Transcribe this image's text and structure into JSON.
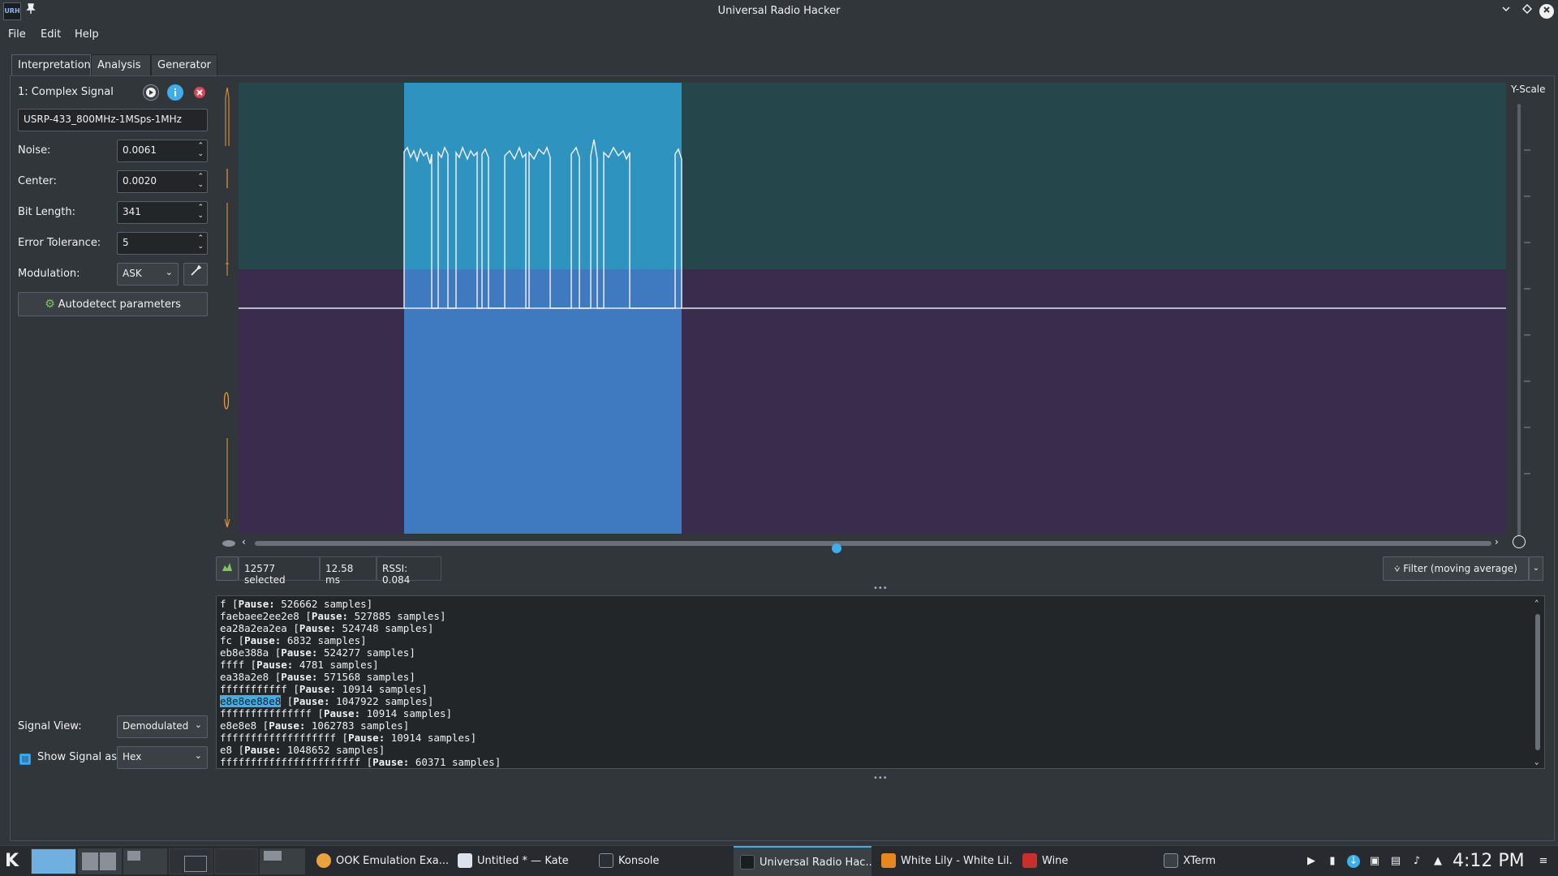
{
  "window": {
    "title": "Universal Radio Hacker",
    "app_icon_text": "URH"
  },
  "menu": [
    "File",
    "Edit",
    "Help"
  ],
  "tabs": [
    "Interpretation",
    "Analysis",
    "Generator"
  ],
  "signal": {
    "name": "1: Complex Signal",
    "filename": "USRP-433_800MHz-1MSps-1MHz"
  },
  "params": {
    "noise_label": "Noise:",
    "noise_value": "0.0061",
    "center_label": "Center:",
    "center_value": "0.0020",
    "bit_length_label": "Bit Length:",
    "bit_length_value": "341",
    "error_tolerance_label": "Error Tolerance:",
    "error_tolerance_value": "5",
    "modulation_label": "Modulation:",
    "modulation_value": "ASK",
    "autodetect_label": "Autodetect parameters",
    "signal_view_label": "Signal View:",
    "signal_view_value": "Demodulated",
    "show_signal_as_label": "Show Signal as",
    "show_signal_as_value": "Hex"
  },
  "graph": {
    "y_scale_label": "Y-Scale",
    "hscroll_position": 0.47
  },
  "status": {
    "selected_count": "12577",
    "selected_label": "selected",
    "duration": "12.58 ms",
    "rssi": "RSSI: 0.084",
    "filter_label": "Filter (moving average)"
  },
  "output_lines": [
    {
      "bits": "f",
      "pause": "526662 samples"
    },
    {
      "bits": "faebaee2ee2e8",
      "pause": "527885 samples"
    },
    {
      "bits": "ea28a2ea2ea",
      "pause": "524748 samples"
    },
    {
      "bits": "fc",
      "pause": "6832 samples"
    },
    {
      "bits": "eb8e388a",
      "pause": "524277 samples"
    },
    {
      "bits": "ffff",
      "pause": "4781 samples"
    },
    {
      "bits": "ea38a2e8",
      "pause": "571568 samples"
    },
    {
      "bits": "fffffffffff",
      "pause": "10914 samples"
    },
    {
      "bits": "e8e8ee88e8",
      "pause": "1047922 samples",
      "highlight": true
    },
    {
      "bits": "fffffffffffffff",
      "pause": "10914 samples"
    },
    {
      "bits": "e8e8e8",
      "pause": "1062783 samples"
    },
    {
      "bits": "fffffffffffffffffff",
      "pause": "10914 samples"
    },
    {
      "bits": "e8",
      "pause": "1048652 samples"
    },
    {
      "bits": "fffffffffffffffffffffff",
      "pause": "60371 samples"
    }
  ],
  "pause_label": "Pause:",
  "taskbar": {
    "tasks": [
      {
        "label": "OOK Emulation Exa...",
        "icon": "chrome-icon",
        "color": "#e8a33d"
      },
      {
        "label": "Untitled * — Kate",
        "icon": "kate-icon",
        "color": "#dde3ea"
      },
      {
        "label": "Konsole",
        "icon": "konsole-icon",
        "color": "#2b2f33"
      },
      {
        "label": "Universal Radio Hac...",
        "icon": "urh-icon",
        "color": "#1b1e20"
      },
      {
        "label": "White Lily - White Lil...",
        "icon": "vlc-icon",
        "color": "#e8871e"
      },
      {
        "label": "Wine",
        "icon": "wine-icon",
        "color": "#c9302c"
      },
      {
        "label": "XTerm",
        "icon": "xterm-icon",
        "color": "#3b4045"
      }
    ],
    "clock": "4:12 PM"
  },
  "colors": {
    "accent": "#3daee9",
    "selection_upper": "#2e93bf",
    "selection_lower": "#3f79c0",
    "band_upper": "#25464a",
    "band_lower": "#3a2c4c"
  }
}
